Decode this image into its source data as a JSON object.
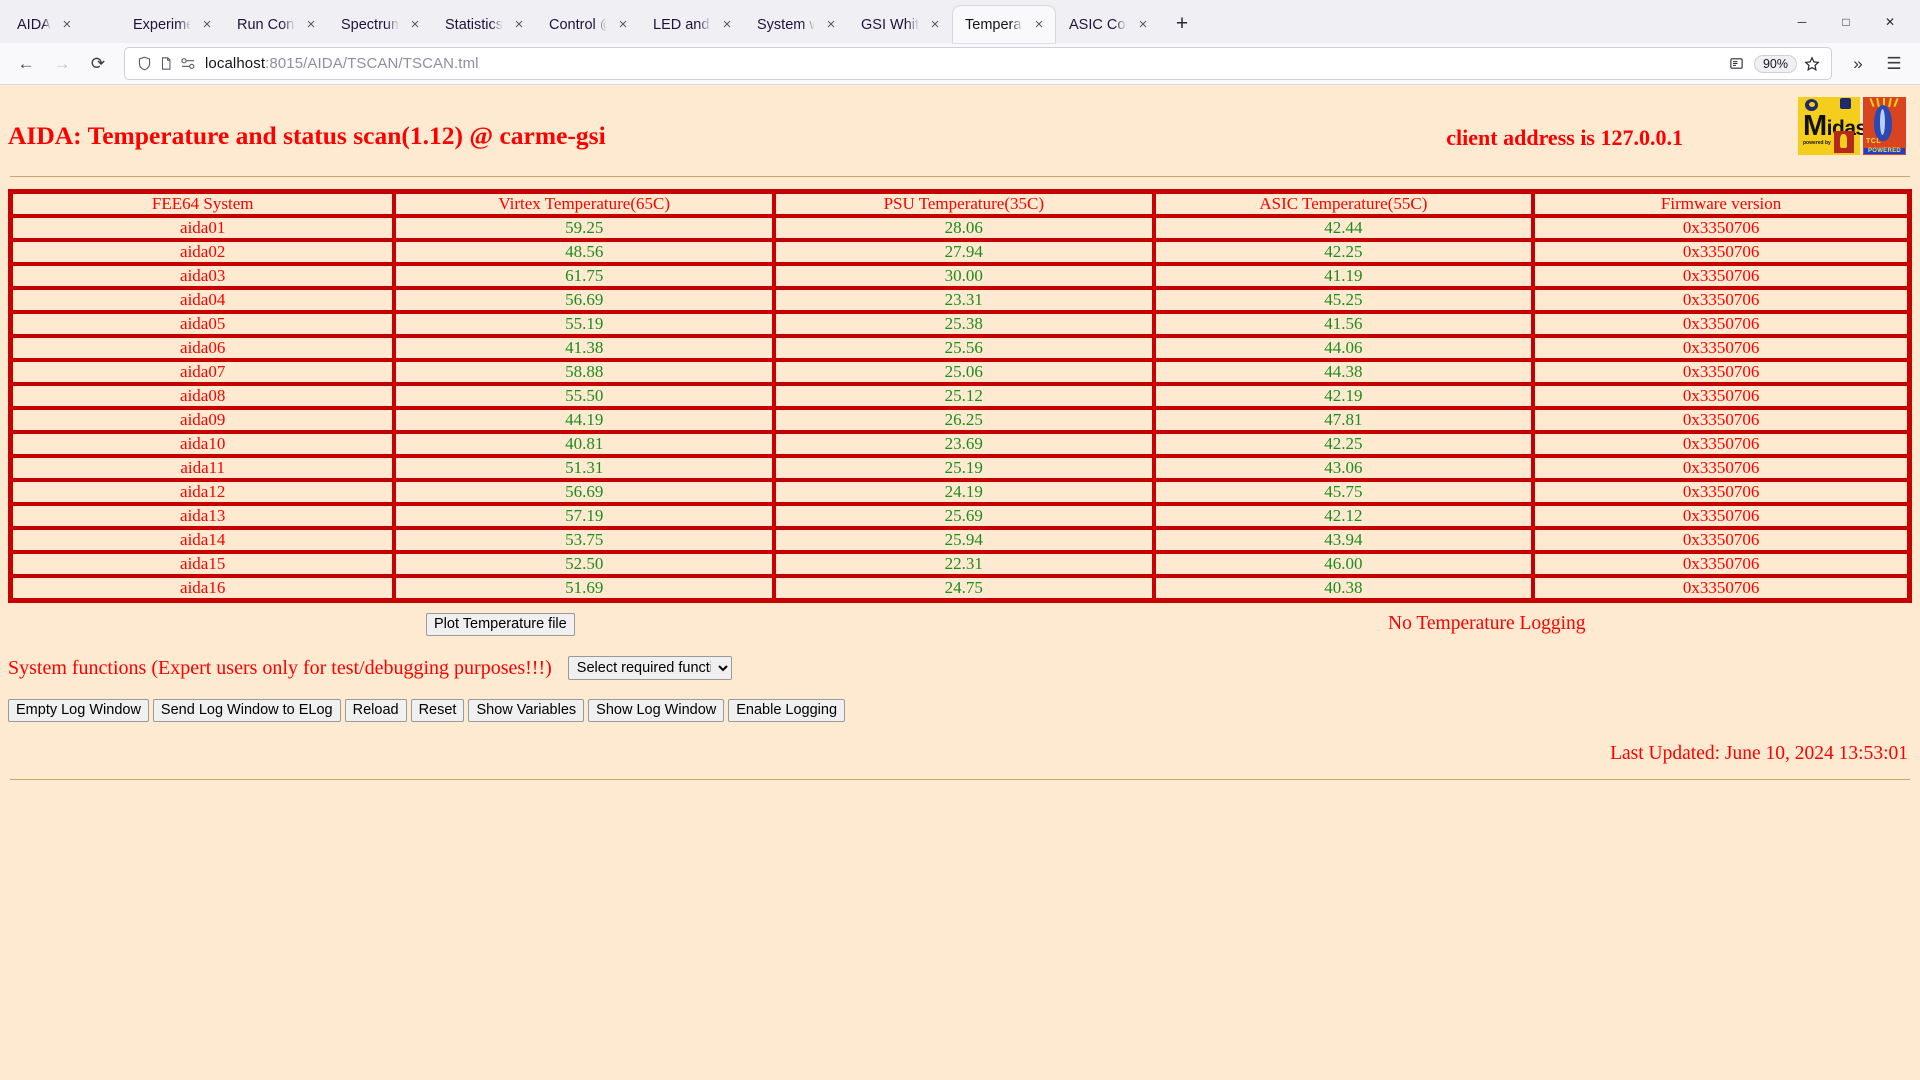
{
  "browser": {
    "tabs": [
      {
        "label": "AIDA",
        "active": false
      },
      {
        "label": "Experiment Control",
        "active": false
      },
      {
        "label": "Run Control @ carme-gsi",
        "active": false
      },
      {
        "label": "Spectrum Browser",
        "active": false
      },
      {
        "label": "Statistics @ carme-gsi",
        "active": false
      },
      {
        "label": "Control @ carme-gsi",
        "active": false
      },
      {
        "label": "LED and Waveform",
        "active": false
      },
      {
        "label": "System wide Checks",
        "active": false
      },
      {
        "label": "GSI White Rabbit Time",
        "active": false
      },
      {
        "label": "Temperature and status scan",
        "active": true
      },
      {
        "label": "ASIC Control @ carme-gsi",
        "active": false
      }
    ],
    "tab_close_label": "×",
    "newtab_label": "+",
    "window_controls": {
      "minimize": "─",
      "maximize": "□",
      "close": "✕"
    },
    "nav": {
      "back": "←",
      "forward": "→",
      "reload": "⟳"
    },
    "url": {
      "host": "localhost",
      "path": ":8015/AIDA/TSCAN/TSCAN.tml"
    },
    "zoom_level": "90%",
    "toolbar_right": {
      "overflow": "»",
      "menu": "☰"
    }
  },
  "page": {
    "title": "AIDA: Temperature and status scan(1.12) @ carme-gsi",
    "client_address": "client address is 127.0.0.1",
    "logos": {
      "midas_word": "idas",
      "midas_big": "M",
      "midas_powered": "powered by",
      "midas_tcl": "TCL",
      "tcl_word": "TCL",
      "tcl_powered": "POWERED"
    },
    "table": {
      "headers": [
        "FEE64 System",
        "Virtex Temperature(65C)",
        "PSU Temperature(35C)",
        "ASIC Temperature(55C)",
        "Firmware version"
      ],
      "rows": [
        {
          "system": "aida01",
          "virtex": "59.25",
          "psu": "28.06",
          "asic": "42.44",
          "firmware": "0x3350706"
        },
        {
          "system": "aida02",
          "virtex": "48.56",
          "psu": "27.94",
          "asic": "42.25",
          "firmware": "0x3350706"
        },
        {
          "system": "aida03",
          "virtex": "61.75",
          "psu": "30.00",
          "asic": "41.19",
          "firmware": "0x3350706"
        },
        {
          "system": "aida04",
          "virtex": "56.69",
          "psu": "23.31",
          "asic": "45.25",
          "firmware": "0x3350706"
        },
        {
          "system": "aida05",
          "virtex": "55.19",
          "psu": "25.38",
          "asic": "41.56",
          "firmware": "0x3350706"
        },
        {
          "system": "aida06",
          "virtex": "41.38",
          "psu": "25.56",
          "asic": "44.06",
          "firmware": "0x3350706"
        },
        {
          "system": "aida07",
          "virtex": "58.88",
          "psu": "25.06",
          "asic": "44.38",
          "firmware": "0x3350706"
        },
        {
          "system": "aida08",
          "virtex": "55.50",
          "psu": "25.12",
          "asic": "42.19",
          "firmware": "0x3350706"
        },
        {
          "system": "aida09",
          "virtex": "44.19",
          "psu": "26.25",
          "asic": "47.81",
          "firmware": "0x3350706"
        },
        {
          "system": "aida10",
          "virtex": "40.81",
          "psu": "23.69",
          "asic": "42.25",
          "firmware": "0x3350706"
        },
        {
          "system": "aida11",
          "virtex": "51.31",
          "psu": "25.19",
          "asic": "43.06",
          "firmware": "0x3350706"
        },
        {
          "system": "aida12",
          "virtex": "56.69",
          "psu": "24.19",
          "asic": "45.75",
          "firmware": "0x3350706"
        },
        {
          "system": "aida13",
          "virtex": "57.19",
          "psu": "25.69",
          "asic": "42.12",
          "firmware": "0x3350706"
        },
        {
          "system": "aida14",
          "virtex": "53.75",
          "psu": "25.94",
          "asic": "43.94",
          "firmware": "0x3350706"
        },
        {
          "system": "aida15",
          "virtex": "52.50",
          "psu": "22.31",
          "asic": "46.00",
          "firmware": "0x3350706"
        },
        {
          "system": "aida16",
          "virtex": "51.69",
          "psu": "24.75",
          "asic": "40.38",
          "firmware": "0x3350706"
        }
      ]
    },
    "controls": {
      "plot_button": "Plot Temperature file",
      "logging_status": "No Temperature Logging",
      "system_functions_label": "System functions (Expert users only for test/debugging purposes!!!)",
      "function_select_value": "Select required function",
      "buttons": [
        "Empty Log Window",
        "Send Log Window to ELog",
        "Reload",
        "Reset",
        "Show Variables",
        "Show Log Window",
        "Enable Logging"
      ]
    },
    "last_updated": "Last Updated: June 10, 2024 13:53:01"
  },
  "colors": {
    "page_bg": "#fdead0",
    "red_text": "#fd0000",
    "table_border": "#c80000",
    "green_value": "#1e8c1e"
  }
}
